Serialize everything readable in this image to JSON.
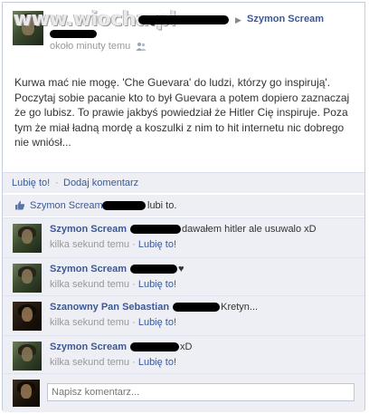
{
  "watermark": {
    "text_main": "www.wiocha",
    "text_dot": ".",
    "text_end": "pl"
  },
  "post": {
    "target_name": "Szymon Scream",
    "timestamp": "około minuty temu",
    "body": "Kurwa mać nie mogę. 'Che Guevara' do ludzi, którzy go inspirują'. Poczytaj sobie pacanie kto to był Guevara a potem dopiero zaznaczaj że go lubisz. To prawie jakbyś powiedział że Hitler Cię inspiruje. Poza tym że miał ładną mordę a koszulki z nim to hit internetu nic dobrego nie wniósł..."
  },
  "actions": {
    "like": "Lubię to!",
    "separator": "·",
    "comment": "Dodaj komentarz"
  },
  "likes": {
    "name": "Szymon Scream",
    "suffix": "lubi to."
  },
  "comments": [
    {
      "author": "Szymon Scream",
      "text": "dawałem hitler ale usuwalo xD",
      "time": "kilka sekund temu",
      "like": "Lubię to!"
    },
    {
      "author": "Szymon Scream",
      "text": "♥",
      "time": "kilka sekund temu",
      "like": "Lubię to!"
    },
    {
      "author": "Szanowny Pan Sebastian",
      "text": "Kretyn...",
      "time": "kilka sekund temu",
      "like": "Lubię to!"
    },
    {
      "author": "Szymon Scream",
      "text": "xD",
      "time": "kilka sekund temu",
      "like": "Lubię to!"
    }
  ],
  "composer": {
    "placeholder": "Napisz komentarz..."
  },
  "colors": {
    "link": "#3b5998",
    "panel": "#edeff4",
    "border": "#c4cde0"
  }
}
